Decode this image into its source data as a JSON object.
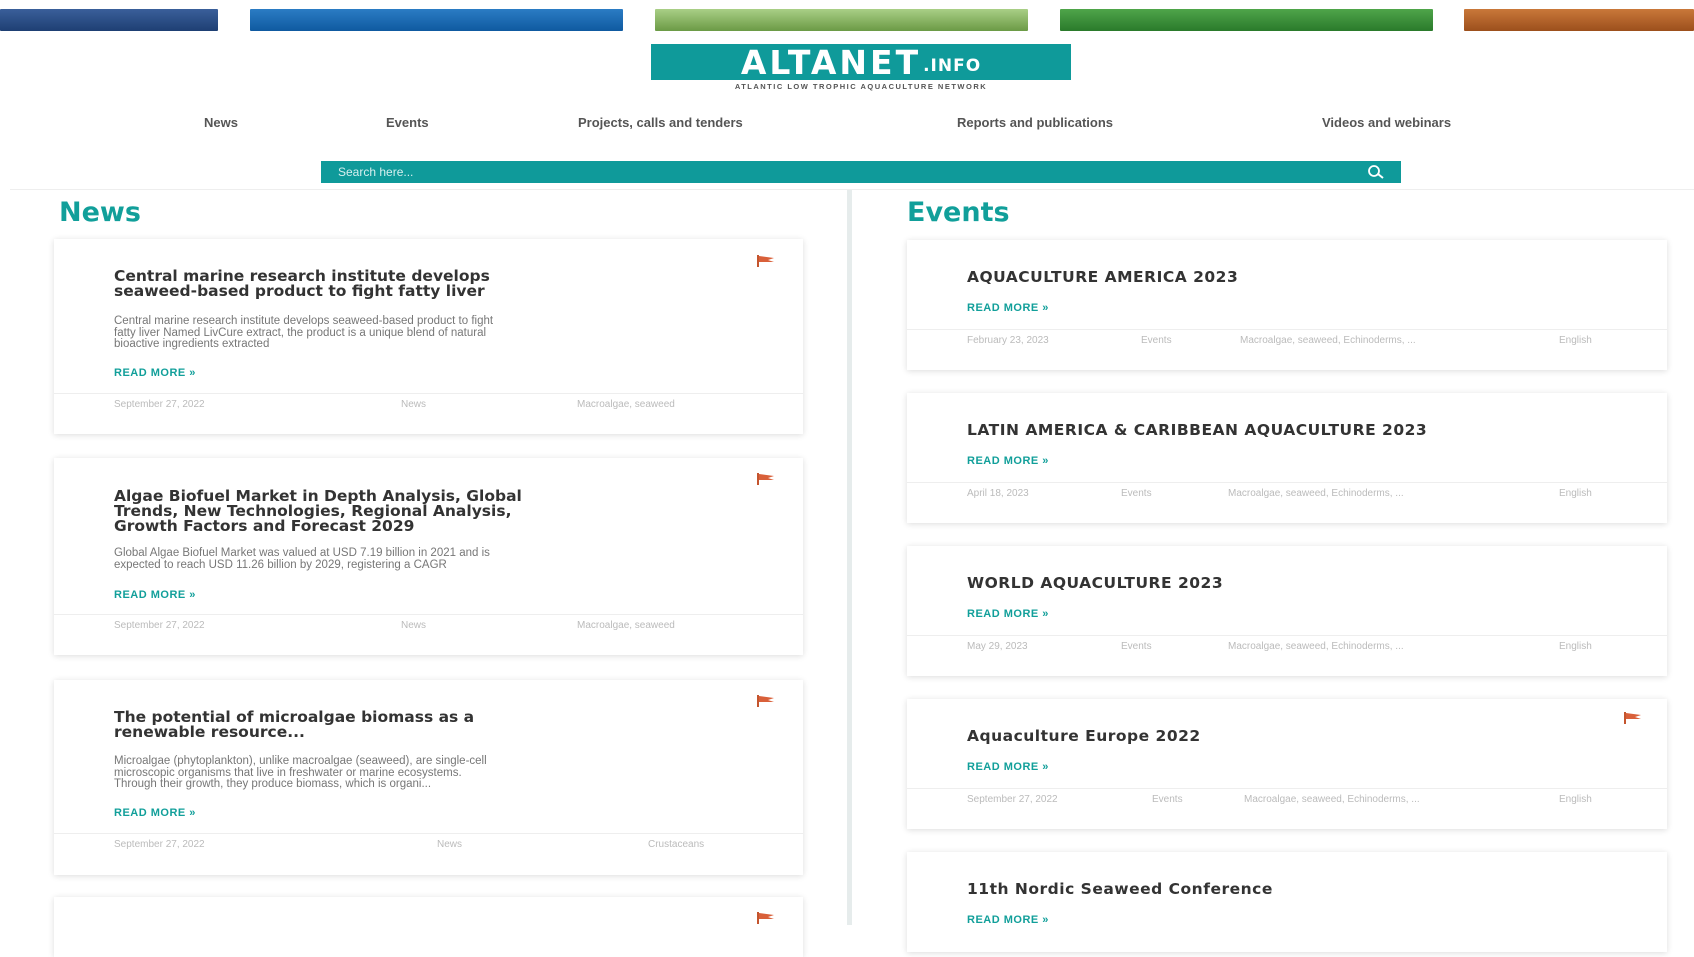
{
  "header": {
    "logo_main": "ALTANET",
    "logo_suffix": ".INFO",
    "tagline": "ATLANTIC LOW TROPHIC AQUACULTURE NETWORK",
    "brand_colors": [
      "#1e3f73",
      "#0f5aa0",
      "#8bb865",
      "#3a8f3a",
      "#b5652b"
    ]
  },
  "nav": [
    "News",
    "Events",
    "Projects, calls and tenders",
    "Reports and publications",
    "Videos and webinars"
  ],
  "search": {
    "placeholder": "Search here..."
  },
  "accent_color": "#119f9a",
  "news": {
    "title": "News",
    "read_more": "READ MORE »",
    "items": [
      {
        "title_lines": [
          "Central marine research institute develops",
          "seaweed-based product to fight fatty liver"
        ],
        "excerpt_lines": [
          "Central marine research institute develops seaweed-based product to fight",
          "fatty liver Named LivCure extract, the product is a unique blend of natural",
          "bioactive ingredients extracted"
        ],
        "date": "September 27, 2022",
        "category": "News",
        "tags": "Macroalgae, seaweed"
      },
      {
        "title_lines": [
          "Algae Biofuel Market in Depth Analysis, Global",
          "Trends, New Technologies, Regional Analysis,",
          "Growth Factors and Forecast 2029"
        ],
        "excerpt_lines": [
          "Global Algae Biofuel Market was valued at USD 7.19 billion in 2021 and is",
          "expected to reach USD 11.26 billion by 2029, registering a CAGR"
        ],
        "date": "September 27, 2022",
        "category": "News",
        "tags": "Macroalgae, seaweed"
      },
      {
        "title_lines": [
          "The potential of microalgae biomass as a",
          "renewable resource..."
        ],
        "excerpt_lines": [
          "Microalgae (phytoplankton), unlike macroalgae (seaweed), are single-cell",
          "microscopic organisms that live in freshwater or marine ecosystems.",
          "Through their growth, they produce biomass, which is organi..."
        ],
        "date": "September 27, 2022",
        "category": "News",
        "tags": "Crustaceans"
      }
    ]
  },
  "events": {
    "title": "Events",
    "read_more": "READ MORE »",
    "items": [
      {
        "title": "AQUACULTURE AMERICA 2023",
        "date": "February 23, 2023",
        "category": "Events",
        "tags": "Macroalgae, seaweed, Echinoderms, ...",
        "language": "English"
      },
      {
        "title": "LATIN AMERICA & CARIBBEAN AQUACULTURE 2023",
        "date": "April 18, 2023",
        "category": "Events",
        "tags": "Macroalgae, seaweed, Echinoderms, ...",
        "language": "English"
      },
      {
        "title": "WORLD AQUACULTURE 2023",
        "date": "May 29, 2023",
        "category": "Events",
        "tags": "Macroalgae, seaweed, Echinoderms, ...",
        "language": "English"
      },
      {
        "title": "Aquaculture Europe 2022",
        "date": "September 27, 2022",
        "category": "Events",
        "tags": "Macroalgae, seaweed, Echinoderms, ...",
        "language": "English"
      },
      {
        "title": "11th Nordic Seaweed Conference"
      }
    ]
  }
}
